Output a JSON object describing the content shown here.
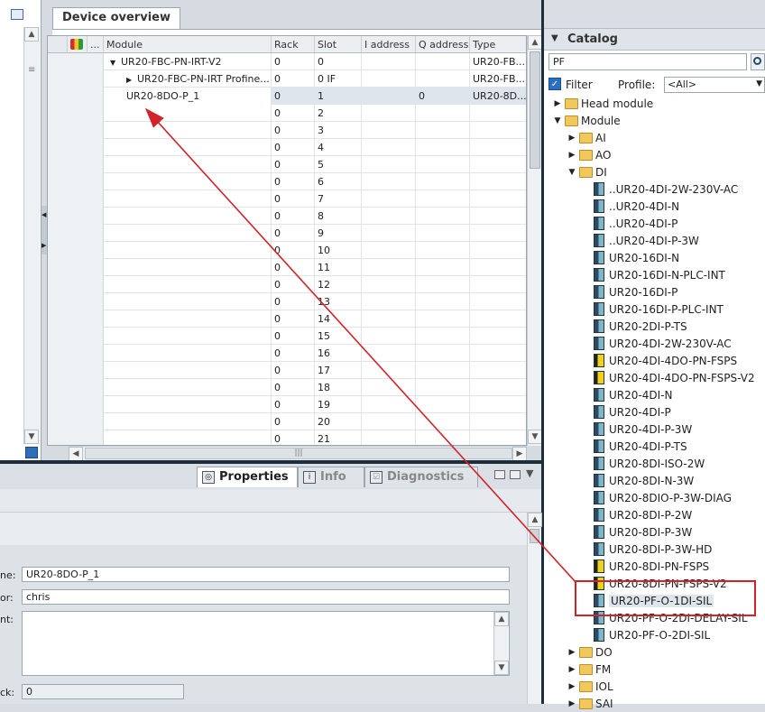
{
  "device_overview": {
    "tab_label": "Device overview",
    "columns": [
      "",
      "...",
      "Module",
      "Rack",
      "Slot",
      "I address",
      "Q address",
      "Type"
    ],
    "rows": [
      {
        "module": "UR20-FBC-PN-IRT-V2",
        "rack": "0",
        "slot": "0",
        "iaddr": "",
        "qaddr": "",
        "type": "UR20-FB...",
        "expander": "▼",
        "indent": 1
      },
      {
        "module": "UR20-FBC-PN-IRT Profine...",
        "rack": "0",
        "slot": "0 IF",
        "iaddr": "",
        "qaddr": "",
        "type": "UR20-FB...",
        "expander": "▶",
        "indent": 2
      },
      {
        "module": "UR20-8DO-P_1",
        "rack": "0",
        "slot": "1",
        "iaddr": "",
        "qaddr": "0",
        "type": "UR20-8D...",
        "expander": "",
        "indent": 1,
        "selected": true
      },
      {
        "module": "",
        "rack": "0",
        "slot": "2"
      },
      {
        "module": "",
        "rack": "0",
        "slot": "3"
      },
      {
        "module": "",
        "rack": "0",
        "slot": "4"
      },
      {
        "module": "",
        "rack": "0",
        "slot": "5"
      },
      {
        "module": "",
        "rack": "0",
        "slot": "6"
      },
      {
        "module": "",
        "rack": "0",
        "slot": "7"
      },
      {
        "module": "",
        "rack": "0",
        "slot": "8"
      },
      {
        "module": "",
        "rack": "0",
        "slot": "9"
      },
      {
        "module": "",
        "rack": "0",
        "slot": "10"
      },
      {
        "module": "",
        "rack": "0",
        "slot": "11"
      },
      {
        "module": "",
        "rack": "0",
        "slot": "12"
      },
      {
        "module": "",
        "rack": "0",
        "slot": "13"
      },
      {
        "module": "",
        "rack": "0",
        "slot": "14"
      },
      {
        "module": "",
        "rack": "0",
        "slot": "15"
      },
      {
        "module": "",
        "rack": "0",
        "slot": "16"
      },
      {
        "module": "",
        "rack": "0",
        "slot": "17"
      },
      {
        "module": "",
        "rack": "0",
        "slot": "18"
      },
      {
        "module": "",
        "rack": "0",
        "slot": "19"
      },
      {
        "module": "",
        "rack": "0",
        "slot": "20"
      },
      {
        "module": "",
        "rack": "0",
        "slot": "21"
      }
    ]
  },
  "properties": {
    "tabs": [
      {
        "label": "Properties",
        "icon": "properties-icon",
        "active": true
      },
      {
        "label": "Info",
        "icon": "info-icon",
        "active": false
      },
      {
        "label": "Diagnostics",
        "icon": "diagnostics-icon",
        "active": false
      }
    ],
    "fields": {
      "name_label": "ne:",
      "name_value": "UR20-8DO-P_1",
      "author_label": "or:",
      "author_value": "chris",
      "comment_label": "nt:",
      "comment_value": "",
      "rack_label": "ck:",
      "rack_value": "0"
    }
  },
  "catalog": {
    "title": "Catalog",
    "search_value": "PF",
    "filter_label": "Filter",
    "filter_checked": true,
    "profile_label": "Profile:",
    "profile_value": "<All>",
    "tree": [
      {
        "label": "Head module",
        "kind": "folder",
        "level": 0,
        "arrow": "▶"
      },
      {
        "label": "Module",
        "kind": "folder",
        "level": 0,
        "arrow": "▼"
      },
      {
        "label": "AI",
        "kind": "folder",
        "level": 1,
        "arrow": "▶"
      },
      {
        "label": "AO",
        "kind": "folder",
        "level": 1,
        "arrow": "▶"
      },
      {
        "label": "DI",
        "kind": "folder",
        "level": 1,
        "arrow": "▼"
      },
      {
        "label": "..UR20-4DI-2W-230V-AC",
        "kind": "module",
        "level": 2
      },
      {
        "label": "..UR20-4DI-N",
        "kind": "module",
        "level": 2
      },
      {
        "label": "..UR20-4DI-P",
        "kind": "module",
        "level": 2
      },
      {
        "label": "..UR20-4DI-P-3W",
        "kind": "module",
        "level": 2
      },
      {
        "label": "UR20-16DI-N",
        "kind": "module",
        "level": 2
      },
      {
        "label": "UR20-16DI-N-PLC-INT",
        "kind": "module",
        "level": 2
      },
      {
        "label": "UR20-16DI-P",
        "kind": "module",
        "level": 2
      },
      {
        "label": "UR20-16DI-P-PLC-INT",
        "kind": "module",
        "level": 2
      },
      {
        "label": "UR20-2DI-P-TS",
        "kind": "module",
        "level": 2
      },
      {
        "label": "UR20-4DI-2W-230V-AC",
        "kind": "module",
        "level": 2
      },
      {
        "label": "UR20-4DI-4DO-PN-FSPS",
        "kind": "module-yellow",
        "level": 2
      },
      {
        "label": "UR20-4DI-4DO-PN-FSPS-V2",
        "kind": "module-yellow",
        "level": 2
      },
      {
        "label": "UR20-4DI-N",
        "kind": "module",
        "level": 2
      },
      {
        "label": "UR20-4DI-P",
        "kind": "module",
        "level": 2
      },
      {
        "label": "UR20-4DI-P-3W",
        "kind": "module",
        "level": 2
      },
      {
        "label": "UR20-4DI-P-TS",
        "kind": "module",
        "level": 2
      },
      {
        "label": "UR20-8DI-ISO-2W",
        "kind": "module",
        "level": 2
      },
      {
        "label": "UR20-8DI-N-3W",
        "kind": "module",
        "level": 2
      },
      {
        "label": "UR20-8DIO-P-3W-DIAG",
        "kind": "module",
        "level": 2
      },
      {
        "label": "UR20-8DI-P-2W",
        "kind": "module",
        "level": 2
      },
      {
        "label": "UR20-8DI-P-3W",
        "kind": "module",
        "level": 2
      },
      {
        "label": "UR20-8DI-P-3W-HD",
        "kind": "module",
        "level": 2
      },
      {
        "label": "UR20-8DI-PN-FSPS",
        "kind": "module-yellow",
        "level": 2
      },
      {
        "label": "UR20-8DI-PN-FSPS-V2",
        "kind": "module-yellow",
        "level": 2
      },
      {
        "label": "UR20-PF-O-1DI-SIL",
        "kind": "module",
        "level": 2,
        "selected": true
      },
      {
        "label": "UR20-PF-O-2DI-DELAY-SIL",
        "kind": "module",
        "level": 2
      },
      {
        "label": "UR20-PF-O-2DI-SIL",
        "kind": "module",
        "level": 2
      },
      {
        "label": "DO",
        "kind": "folder",
        "level": 1,
        "arrow": "▶"
      },
      {
        "label": "FM",
        "kind": "folder",
        "level": 1,
        "arrow": "▶"
      },
      {
        "label": "IOL",
        "kind": "folder",
        "level": 1,
        "arrow": "▶"
      },
      {
        "label": "SAI",
        "kind": "folder",
        "level": 1,
        "arrow": "▶"
      }
    ]
  },
  "colors": {
    "annotation": "#d2232a",
    "selection": "#dfe5ec",
    "accent": "#2a6fc0"
  }
}
